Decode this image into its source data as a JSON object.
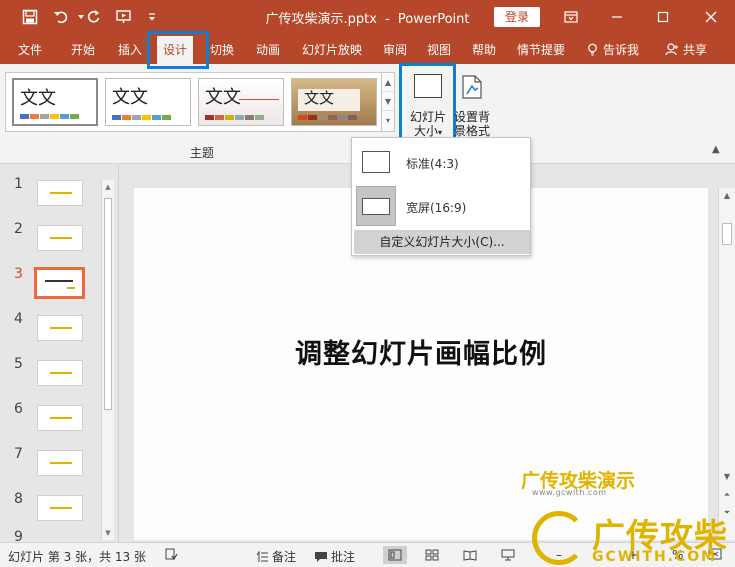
{
  "window": {
    "title_file": "广传攻柴演示.pptx",
    "title_separator": "-",
    "title_app": "PowerPoint",
    "login_label": "登录"
  },
  "quick_access": [
    "save-icon",
    "undo-icon",
    "redo-icon",
    "present-icon",
    "customize-icon"
  ],
  "tabs": [
    {
      "label": "文件"
    },
    {
      "label": "开始"
    },
    {
      "label": "插入"
    },
    {
      "label": "设计",
      "active": true
    },
    {
      "label": "切换"
    },
    {
      "label": "动画"
    },
    {
      "label": "幻灯片放映"
    },
    {
      "label": "审阅"
    },
    {
      "label": "视图"
    },
    {
      "label": "帮助"
    },
    {
      "label": "情节提要"
    }
  ],
  "tell_me": "告诉我",
  "share": "共享",
  "ribbon": {
    "themes_group_label": "主题",
    "theme_thumbnail_text": "文文",
    "theme_thumbnail_text_2": "文文",
    "slide_size_label_1": "幻灯片",
    "slide_size_label_2": "大小",
    "format_bg_label_1": "设置背",
    "format_bg_label_2": "景格式"
  },
  "slide_size_menu": {
    "items": [
      {
        "label": "标准(4:3)",
        "selected": false
      },
      {
        "label": "宽屏(16:9)",
        "selected": true
      }
    ],
    "custom_label": "自定义幻灯片大小(C)..."
  },
  "thumbnails": [
    {
      "number": "1"
    },
    {
      "number": "2"
    },
    {
      "number": "3",
      "active": true
    },
    {
      "number": "4"
    },
    {
      "number": "5"
    },
    {
      "number": "6"
    },
    {
      "number": "7"
    },
    {
      "number": "8"
    },
    {
      "number": "9"
    }
  ],
  "slide": {
    "title": "调整幻灯片画幅比例",
    "brand": "广传攻柴演示",
    "url": "www.gcwith.com"
  },
  "status": {
    "slide_info": "幻灯片 第 3 张，共 13 张",
    "notes": "备注",
    "comments": "批注",
    "zoom": "%"
  },
  "watermark": {
    "text": "广传攻柴",
    "url": "GCWITH.COM"
  },
  "colors": {
    "accent": "#b7472a",
    "highlight": "#0f7fd3",
    "brand": "#e0b300"
  }
}
